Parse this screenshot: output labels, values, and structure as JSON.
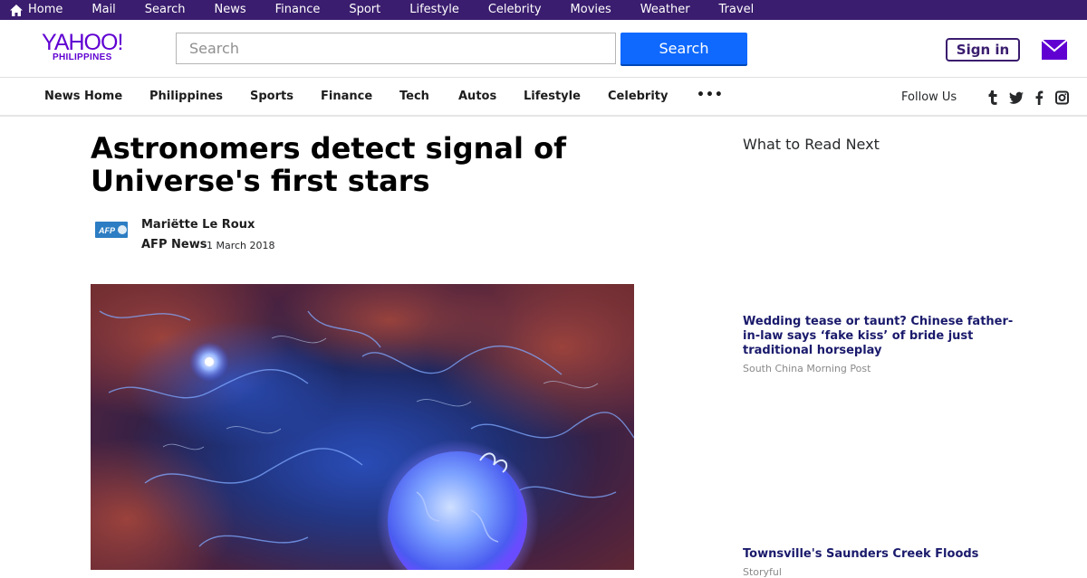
{
  "topbar": {
    "items": [
      "Home",
      "Mail",
      "Search",
      "News",
      "Finance",
      "Sport",
      "Lifestyle",
      "Celebrity",
      "Movies",
      "Weather",
      "Travel"
    ]
  },
  "header": {
    "logo_word": "YAHOO!",
    "logo_sub": "PHILIPPINES",
    "search_placeholder": "Search",
    "search_button": "Search",
    "signin_button": "Sign in"
  },
  "nav": {
    "items": [
      "News Home",
      "Philippines",
      "Sports",
      "Finance",
      "Tech",
      "Autos",
      "Lifestyle",
      "Celebrity"
    ],
    "more": "•••",
    "follow_label": "Follow Us",
    "social_icons": [
      "tumblr-icon",
      "twitter-icon",
      "facebook-icon",
      "instagram-icon"
    ]
  },
  "article": {
    "headline": "Astronomers detect signal of Universe's first stars",
    "author": "Mariëtte Le Roux",
    "source": "AFP News",
    "date": "1 March 2018",
    "source_logo": "AFP"
  },
  "sidebar": {
    "title": "What to Read Next",
    "stories": [
      {
        "title": "Wedding tease or taunt? Chinese father-in-law says ‘fake kiss’ of bride just traditional horseplay",
        "source": "South China Morning Post"
      },
      {
        "title": "Townsville's Saunders Creek Floods",
        "source": "Storyful"
      }
    ]
  },
  "colors": {
    "topbar_bg": "#3a1d6e",
    "brand_purple": "#6001d2",
    "search_blue": "#0f69ff",
    "link_navy": "#1a1a6c"
  }
}
